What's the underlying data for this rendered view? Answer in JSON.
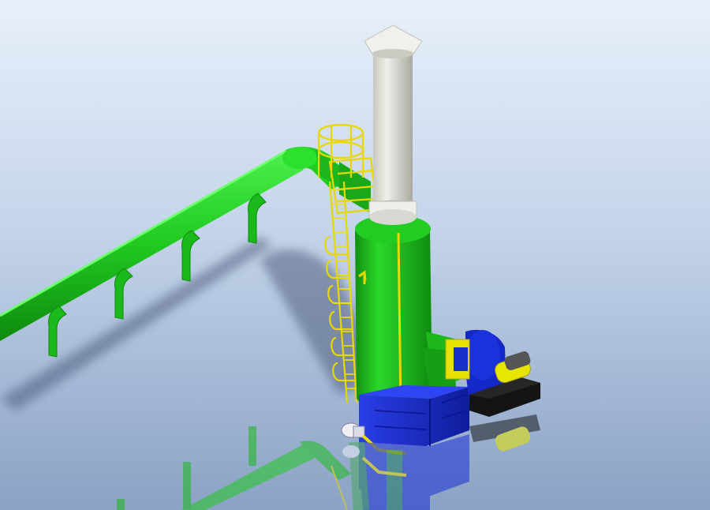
{
  "scene": {
    "background_top": "#e6eef8",
    "background_bottom": "#8ea4c4",
    "pipe_color": "#22d122",
    "pipe_dark": "#0f8f14",
    "stack_color": "#d6d6d0",
    "tower_color": "#1eb81e",
    "ladder_color": "#f2e000",
    "base_color": "#1a2fd0",
    "fan_color": "#1428c8",
    "motor_color": "#e8e800",
    "platform_color": "#141414"
  },
  "objects": [
    {
      "name": "exhaust-stack-cap-icon"
    },
    {
      "name": "exhaust-stack-icon"
    },
    {
      "name": "scrubber-tower-icon"
    },
    {
      "name": "duct-pipe-icon"
    },
    {
      "name": "ladder-icon"
    },
    {
      "name": "fan-housing-icon"
    },
    {
      "name": "motor-icon"
    },
    {
      "name": "pump-icon"
    }
  ]
}
